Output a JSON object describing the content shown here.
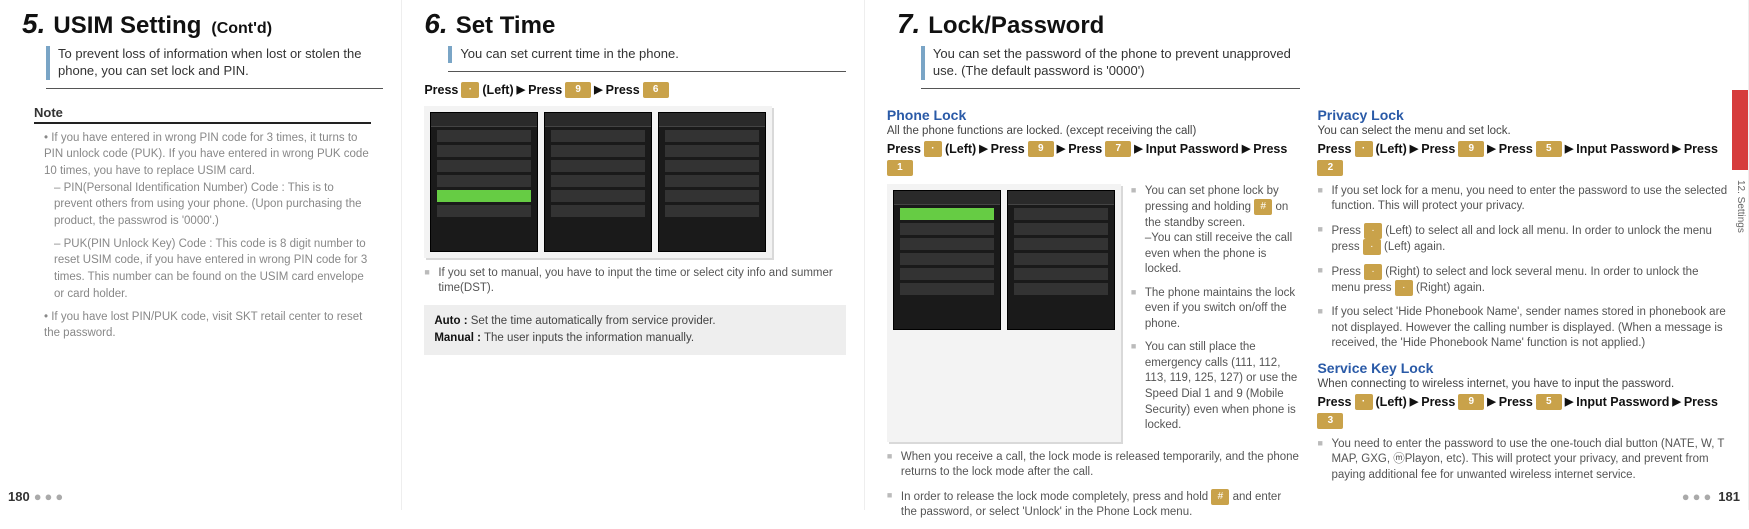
{
  "pageLeftNum": "180",
  "pageRightNum": "181",
  "sideTabLabel": "12. Settings",
  "sec5": {
    "num": "5.",
    "title": "USIM Setting",
    "suffix": "(Cont'd)",
    "intro": "To prevent loss of information when lost or stolen the phone, you can set lock and PIN.",
    "noteLabel": "Note",
    "note_b1": "If you have entered in wrong PIN code for 3 times, it turns to PIN unlock code (PUK). If you have entered in wrong PUK code 10 times, you have to replace USIM card.",
    "note_s1": "PIN(Personal Identification Number) Code : This is to prevent others from using your phone. (Upon purchasing the product, the passwrod is '0000'.)",
    "note_s2": "PUK(PIN Unlock Key) Code : This code is 8 digit number to reset USIM code, if you have entered in wrong PIN code for 3 times. This number can be found on the USIM card envelope or card holder.",
    "note_b2": "If you have lost PIN/PUK code, visit SKT retail center to reset the password."
  },
  "sec6": {
    "num": "6.",
    "title": "Set Time",
    "intro": "You can set current time in the phone.",
    "press_p": "Press",
    "press_left": "(Left)",
    "arrow": "▶",
    "bullet1": "If you set to manual, you have to input the time or select city info and summer time(DST).",
    "auto_l": "Auto :",
    "auto_v": "Set the time automatically from service provider.",
    "man_l": "Manual :",
    "man_v": "The user inputs the information manually."
  },
  "sec7": {
    "num": "7.",
    "title": "Lock/Password",
    "intro": "You can set the password of the phone to prevent unapproved use. (The default password is '0000')",
    "phoneLock": {
      "heading": "Phone Lock",
      "desc": "All the phone functions are locked. (except receiving the call)",
      "press_p": "Press",
      "press_left": "(Left)",
      "arrow": "▶",
      "press_input": "Input Password",
      "side1a": "You can set phone lock by pressing and holding",
      "side1b": "on the standby screen.",
      "side1c": "–You can still receive the call even when the phone is locked.",
      "side2": "The phone maintains the lock even if you switch on/off the phone.",
      "side3": "You can still place the emergency calls (111, 112, 113, 119, 125, 127) or use the Speed Dial 1 and 9 (Mobile Security) even when phone is locked.",
      "below1": "When you receive a call, the lock mode is released temporarily, and the phone returns to the lock mode after the call.",
      "below2a": "In order to release the lock mode completely, press and hold",
      "below2b": "and enter the password, or select 'Unlock' in the Phone Lock menu."
    },
    "privacyLock": {
      "heading": "Privacy Lock",
      "desc": "You can select the menu and set lock.",
      "b1": "If you set lock for a menu, you need to enter the password to use the selected function. This will protect your privacy.",
      "b2a": "Press",
      "b2b": "(Left) to select all and lock all menu. In order to unlock the menu press",
      "b2c": "(Left) again.",
      "b3a": "Press",
      "b3b": "(Right) to select and lock several menu. In order to unlock the menu press",
      "b3c": "(Right) again.",
      "b4": "If you select 'Hide Phonebook Name', sender names stored in phonebook are not displayed. However the calling number is displayed. (When a message is received, the 'Hide Phonebook Name' function is not applied.)"
    },
    "serviceKey": {
      "heading": "Service Key Lock",
      "desc": "When connecting to wireless internet, you have to input the password.",
      "b1": "You need to enter the password to use the one-touch dial button (NATE, W, T MAP, GXG, ⓜPlayon, etc). This will protect your privacy, and prevent from paying additional fee for unwanted wireless internet service."
    }
  },
  "keys": {
    "dot": "·",
    "nine": "9",
    "six": "6",
    "seven": "7",
    "one": "1",
    "two": "2",
    "three": "3",
    "five": "5",
    "hash": "#"
  }
}
